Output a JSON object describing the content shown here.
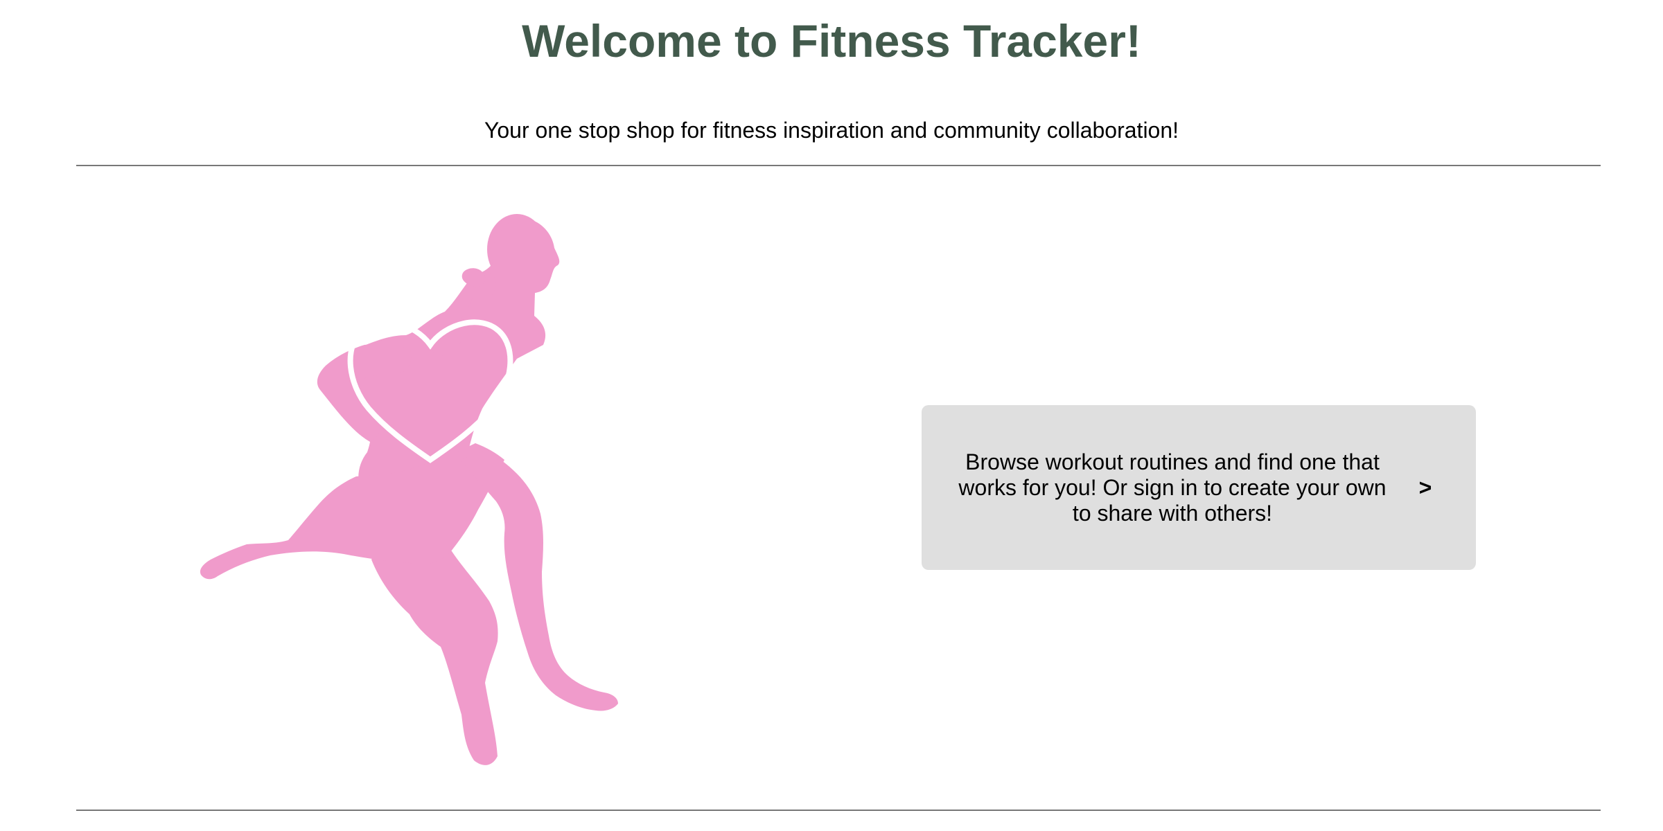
{
  "header": {
    "title": "Welcome to Fitness Tracker!",
    "subtitle": "Your one stop shop for fitness inspiration and community collaboration!"
  },
  "hero": {
    "icon": "running-person-heart-icon"
  },
  "cta": {
    "text": "Browse workout routines and find one that works for you! Or sign in to create your own to share with others!",
    "arrow": ">"
  },
  "colors": {
    "title": "#425a4c",
    "runner": "#f09bcb",
    "heart_outline": "#ffffff",
    "card_background": "#dfdfdf",
    "rule": "#777777"
  }
}
